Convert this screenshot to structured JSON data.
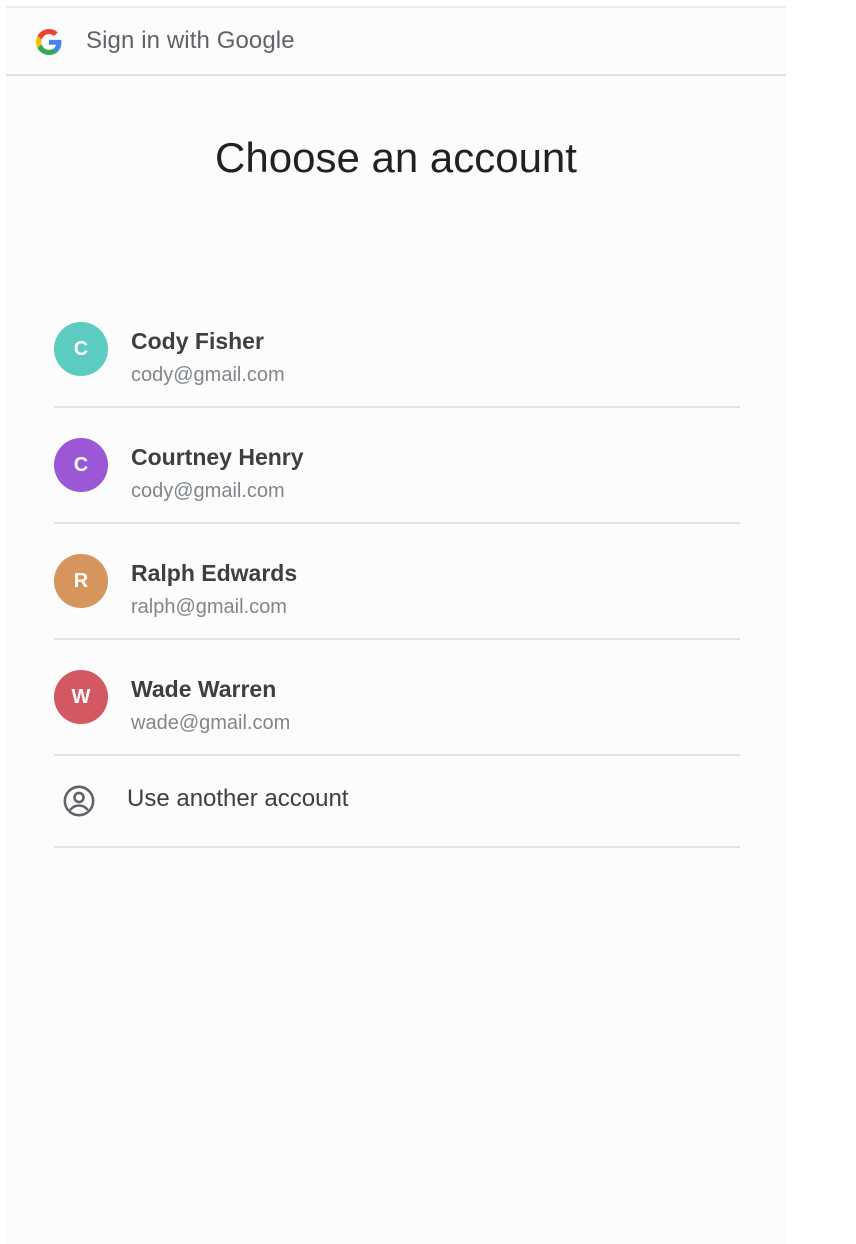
{
  "header": {
    "title": "Sign in with Google",
    "logo_icon": "google-g-icon"
  },
  "main": {
    "title": "Choose an account"
  },
  "accounts": [
    {
      "initial": "C",
      "name": "Cody Fisher",
      "email": "cody@gmail.com",
      "color": "#5ccbc0"
    },
    {
      "initial": "C",
      "name": "Courtney Henry",
      "email": "cody@gmail.com",
      "color": "#9b57d6"
    },
    {
      "initial": "R",
      "name": "Ralph Edwards",
      "email": "ralph@gmail.com",
      "color": "#d5955c"
    },
    {
      "initial": "W",
      "name": "Wade Warren",
      "email": "wade@gmail.com",
      "color": "#d45862"
    }
  ],
  "another_account": {
    "label": "Use another account",
    "icon": "account-circle-icon"
  }
}
